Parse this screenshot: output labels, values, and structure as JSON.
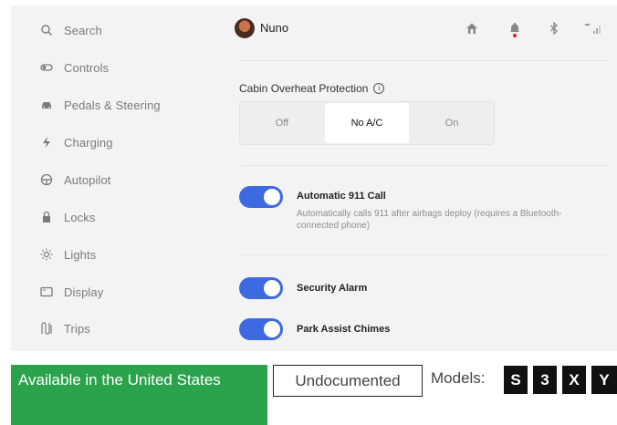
{
  "sidebar": {
    "items": [
      {
        "label": "Search",
        "icon": "search-icon"
      },
      {
        "label": "Controls",
        "icon": "controls-toggle-icon"
      },
      {
        "label": "Pedals & Steering",
        "icon": "car-icon"
      },
      {
        "label": "Charging",
        "icon": "lightning-bolt-icon"
      },
      {
        "label": "Autopilot",
        "icon": "steering-wheel-icon"
      },
      {
        "label": "Locks",
        "icon": "lock-icon"
      },
      {
        "label": "Lights",
        "icon": "sun-icon"
      },
      {
        "label": "Display",
        "icon": "display-icon"
      },
      {
        "label": "Trips",
        "icon": "trips-route-icon"
      }
    ]
  },
  "header": {
    "username": "Nuno",
    "icons": [
      "home-icon",
      "bell-icon",
      "bluetooth-icon",
      "signal-icon"
    ]
  },
  "cabin_overheat": {
    "label": "Cabin Overheat Protection",
    "options": [
      "Off",
      "No A/C",
      "On"
    ],
    "selected": "No A/C"
  },
  "settings": [
    {
      "title": "Automatic 911 Call",
      "description": "Automatically calls 911 after airbags deploy (requires a Bluetooth-connected phone)",
      "enabled": true
    },
    {
      "title": "Security Alarm",
      "enabled": true
    },
    {
      "title": "Park Assist Chimes",
      "enabled": true
    }
  ],
  "footer": {
    "availability": "Available in the United States",
    "availability_color": "#2ba24c",
    "status": "Undocumented",
    "models_label": "Models:",
    "models": [
      "S",
      "3",
      "X",
      "Y"
    ]
  },
  "colors": {
    "toggle_on": "#3e6ae1",
    "panel_bg": "#f3f3f3"
  }
}
